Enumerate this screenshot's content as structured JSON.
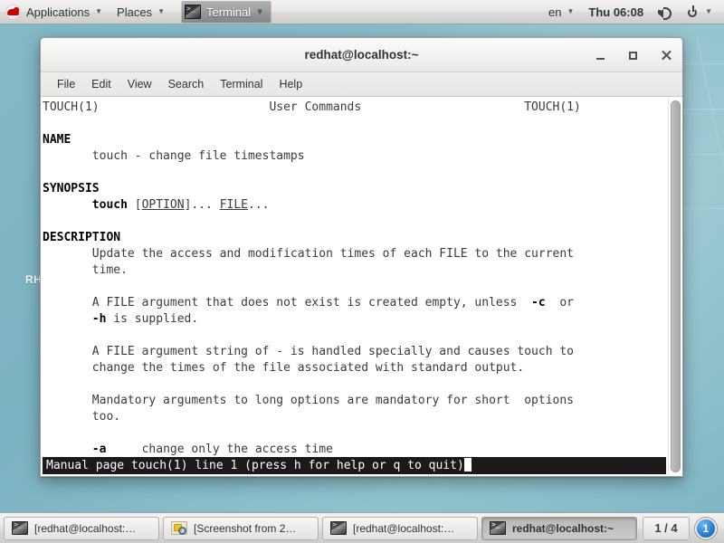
{
  "desktop": {
    "watermark_text": "RH"
  },
  "top_panel": {
    "applications_label": "Applications",
    "places_label": "Places",
    "active_app_label": "Terminal",
    "keyboard_layout": "en",
    "clock": "Thu 06:08",
    "caret_glyph": "▼",
    "icons": {
      "redhat": "redhat-logo",
      "terminal": "terminal-icon",
      "volume": "speaker-icon",
      "power": "power-icon"
    }
  },
  "window": {
    "title": "redhat@localhost:~",
    "menus": [
      "File",
      "Edit",
      "View",
      "Search",
      "Terminal",
      "Help"
    ],
    "buttons": {
      "minimize": "minimize-button",
      "maximize": "maximize-button",
      "close": "close-button"
    }
  },
  "terminal": {
    "lines": [
      "TOUCH(1)                        User Commands                       TOUCH(1)",
      "",
      "<b>NAME</b>",
      "       touch - change file timestamps",
      "",
      "<b>SYNOPSIS</b>",
      "       <b>touch</b> [<u>OPTION</u>]... <u>FILE</u>...",
      "",
      "<b>DESCRIPTION</b>",
      "       Update the access and modification times of each FILE to the current",
      "       time.",
      "",
      "       A FILE argument that does not exist is created empty, unless  <b>-c</b>  or",
      "       <b>-h</b> is supplied.",
      "",
      "       A FILE argument string of - is handled specially and causes touch to",
      "       change the times of the file associated with standard output.",
      "",
      "       Mandatory arguments to long options are mandatory for short  options",
      "       too.",
      "",
      "       <b>-a</b>     change only the access time"
    ],
    "status_line": "Manual page touch(1) line 1 (press h for help or q to quit)"
  },
  "taskbar": {
    "tasks": [
      {
        "label": "[redhat@localhost:…",
        "icon": "terminal-icon",
        "active": false
      },
      {
        "label": "[Screenshot from 2…",
        "icon": "image-viewer-icon",
        "active": false
      },
      {
        "label": "[redhat@localhost:…",
        "icon": "terminal-icon",
        "active": false
      },
      {
        "label": "redhat@localhost:~",
        "icon": "terminal-icon",
        "active": true
      }
    ],
    "workspace": "1 / 4",
    "notification_count": "1"
  },
  "colors": {
    "desktop": "#86b9c6",
    "panel": "#e9e8e7",
    "terminal_bg": "#ffffff",
    "terminal_fg": "#3b3b3b",
    "status_bg": "#1a1a1a",
    "accent_blue": "#2a7fd4",
    "redhat_red": "#cc0000"
  }
}
